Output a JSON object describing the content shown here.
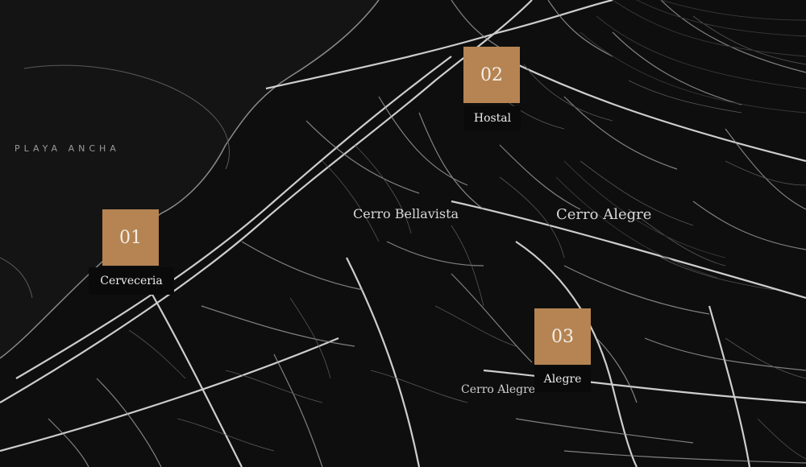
{
  "map": {
    "areas": {
      "playa": "PLAYA ANCHA",
      "bellavista": "Cerro Bellavista",
      "alegre": "Cerro Alegre",
      "lower": "Cerro Alegre"
    },
    "markers": [
      {
        "number": "01",
        "name": "Cerveceria"
      },
      {
        "number": "02",
        "name": "Hostal"
      },
      {
        "number": "03",
        "name": "Alegre"
      }
    ],
    "colors": {
      "background": "#0e0e0e",
      "water": "#141414",
      "streets": "#d9d9d9",
      "marker": "#b58452",
      "label_bg": "#0a0a0a"
    }
  }
}
